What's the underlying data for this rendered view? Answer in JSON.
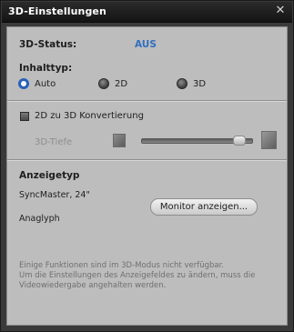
{
  "window": {
    "title": "3D-Einstellungen",
    "close_glyph": "✕"
  },
  "status": {
    "label": "3D-Status:",
    "value": "AUS",
    "value_color": "#2f6fbf"
  },
  "content_type": {
    "label": "Inhalttyp:",
    "options": [
      {
        "label": "Auto",
        "selected": true
      },
      {
        "label": "2D",
        "selected": false
      },
      {
        "label": "3D",
        "selected": false
      }
    ]
  },
  "conversion": {
    "checkbox_label": "2D zu 3D Konvertierung",
    "checked": false,
    "depth_label": "3D-Tiefe",
    "depth_level": 0.93
  },
  "display": {
    "heading": "Anzeigetyp",
    "monitor": "SyncMaster, 24\"",
    "mode": "Anaglyph",
    "show_monitor_button": "Monitor anzeigen..."
  },
  "note": {
    "lines": [
      "Einige Funktionen sind im 3D-Modus nicht verfügbar.",
      "Um die Einstellungen des Anzeigefeldes zu ändern, muss die",
      "Videowiedergabe angehalten werden."
    ]
  }
}
